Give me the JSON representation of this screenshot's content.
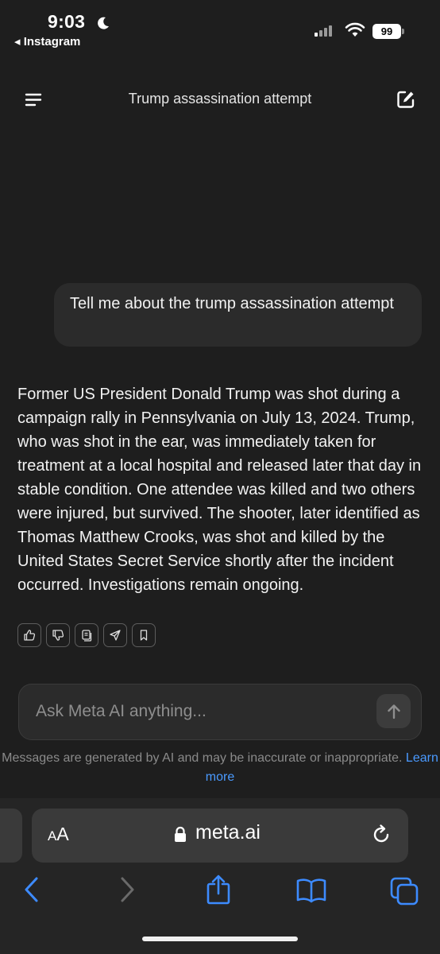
{
  "status_bar": {
    "time": "9:03",
    "back_app": "◂ Instagram",
    "battery": "99"
  },
  "header": {
    "title": "Trump assassination attempt"
  },
  "conversation": {
    "user_message": "Tell me about the trump assassination attempt",
    "ai_response": "Former US President Donald Trump was shot during a campaign rally in Pennsylvania on July 13, 2024. Trump, who was shot in the ear, was immediately taken for treatment at a local hospital and released later that day in stable condition. One attendee was killed and two others were injured, but survived. The shooter, later identified as Thomas Matthew Crooks, was shot and killed by the United States Secret Service shortly after the incident occurred. Investigations remain ongoing.",
    "reaction_icons": [
      "thumbs-up-icon",
      "thumbs-down-icon",
      "copy-icon",
      "share-icon",
      "bookmark-icon"
    ]
  },
  "composer": {
    "placeholder": "Ask Meta AI anything...",
    "disclaimer": "Messages are generated by AI and may be inaccurate or inappropriate.",
    "learn_more": "Learn more"
  },
  "browser": {
    "aa_label_small": "A",
    "aa_label_large": "A",
    "url": "meta.ai"
  },
  "colors": {
    "background": "#1e1e1e",
    "bubble": "#2b2b2b",
    "link": "#4a9aff",
    "nav_icon": "#3d8bff"
  }
}
